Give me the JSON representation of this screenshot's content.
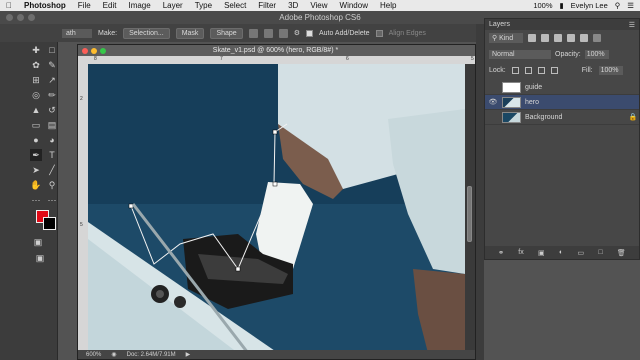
{
  "menubar": {
    "apple": "",
    "app_name": "Photoshop",
    "items": [
      "File",
      "Edit",
      "Image",
      "Layer",
      "Type",
      "Select",
      "Filter",
      "3D",
      "View",
      "Window",
      "Help"
    ],
    "battery": "100%",
    "battery_icon": "battery-icon",
    "user": "Evelyn Lee"
  },
  "app_title": "Adobe Photoshop CS6",
  "options_bar": {
    "tool_preset": "ath",
    "make_label": "Make:",
    "selection_btn": "Selection...",
    "mask_btn": "Mask",
    "shape_btn": "Shape",
    "auto_add_delete": "Auto Add/Delete",
    "align_edges": "Align Edges"
  },
  "document": {
    "title": "Skate_v1.psd @ 600% (hero, RGB/8#) *",
    "zoom": "600%",
    "doc_size": "Doc: 2.64M/7.91M",
    "ruler_h": [
      "8",
      "7",
      "6",
      "5"
    ],
    "ruler_v": [
      "2",
      "5"
    ]
  },
  "colors": {
    "foreground": "#e10a17",
    "background": "#000000"
  },
  "layers_panel": {
    "tab": "Layers",
    "filter_kind": "Kind",
    "blend_mode": "Normal",
    "opacity_label": "Opacity:",
    "opacity": "100%",
    "lock_label": "Lock:",
    "fill_label": "Fill:",
    "fill": "100%",
    "layers": [
      {
        "name": "guide",
        "visible": false,
        "selected": false,
        "locked": false
      },
      {
        "name": "hero",
        "visible": true,
        "selected": true,
        "locked": false
      },
      {
        "name": "Background",
        "visible": false,
        "selected": false,
        "locked": true
      }
    ]
  }
}
